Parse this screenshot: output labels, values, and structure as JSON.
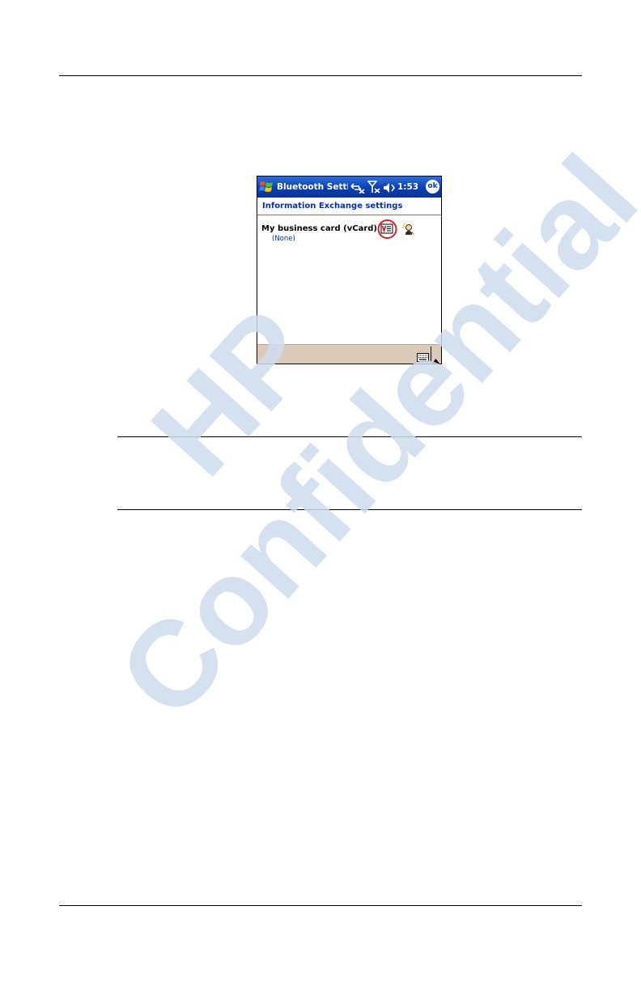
{
  "device": {
    "title_bar": {
      "app_title": "Bluetooth Settings",
      "clock": "1:53",
      "ok_label": "ok",
      "icons": [
        "windows-start-icon",
        "connectivity-icon",
        "antenna-signal-icon",
        "volume-icon"
      ]
    },
    "section_header": "Information Exchange settings",
    "vcard": {
      "label": "My business card (vCard)",
      "value": "(None)",
      "icons": [
        "vcard-icon",
        "contact-picker-icon"
      ]
    },
    "bottom_bar": {
      "icons": [
        "keyboard-icon",
        "sip-up-arrow-icon"
      ]
    }
  },
  "watermark": {
    "line1": "HP",
    "line2": "Confidential",
    "color": "#cfdcee"
  },
  "colors": {
    "title_bar": "#0b3fb0",
    "header_text": "#0a2ea8",
    "bottom_bar": "#dccab8",
    "highlight_circle": "#d9212a"
  }
}
